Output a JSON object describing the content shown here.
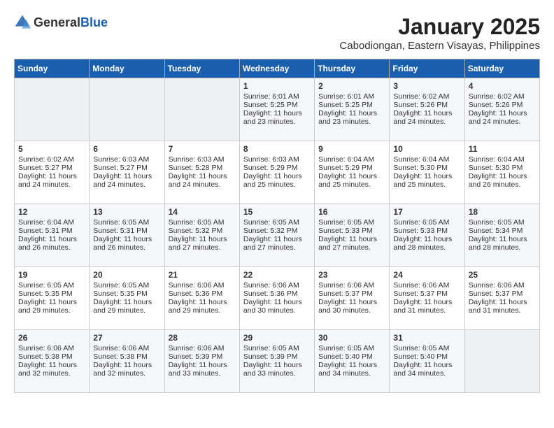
{
  "logo": {
    "general": "General",
    "blue": "Blue"
  },
  "title": "January 2025",
  "subtitle": "Cabodiongan, Eastern Visayas, Philippines",
  "weekdays": [
    "Sunday",
    "Monday",
    "Tuesday",
    "Wednesday",
    "Thursday",
    "Friday",
    "Saturday"
  ],
  "weeks": [
    [
      {
        "day": "",
        "sunrise": "",
        "sunset": "",
        "daylight": ""
      },
      {
        "day": "",
        "sunrise": "",
        "sunset": "",
        "daylight": ""
      },
      {
        "day": "",
        "sunrise": "",
        "sunset": "",
        "daylight": ""
      },
      {
        "day": "1",
        "sunrise": "Sunrise: 6:01 AM",
        "sunset": "Sunset: 5:25 PM",
        "daylight": "Daylight: 11 hours and 23 minutes."
      },
      {
        "day": "2",
        "sunrise": "Sunrise: 6:01 AM",
        "sunset": "Sunset: 5:25 PM",
        "daylight": "Daylight: 11 hours and 23 minutes."
      },
      {
        "day": "3",
        "sunrise": "Sunrise: 6:02 AM",
        "sunset": "Sunset: 5:26 PM",
        "daylight": "Daylight: 11 hours and 24 minutes."
      },
      {
        "day": "4",
        "sunrise": "Sunrise: 6:02 AM",
        "sunset": "Sunset: 5:26 PM",
        "daylight": "Daylight: 11 hours and 24 minutes."
      }
    ],
    [
      {
        "day": "5",
        "sunrise": "Sunrise: 6:02 AM",
        "sunset": "Sunset: 5:27 PM",
        "daylight": "Daylight: 11 hours and 24 minutes."
      },
      {
        "day": "6",
        "sunrise": "Sunrise: 6:03 AM",
        "sunset": "Sunset: 5:27 PM",
        "daylight": "Daylight: 11 hours and 24 minutes."
      },
      {
        "day": "7",
        "sunrise": "Sunrise: 6:03 AM",
        "sunset": "Sunset: 5:28 PM",
        "daylight": "Daylight: 11 hours and 24 minutes."
      },
      {
        "day": "8",
        "sunrise": "Sunrise: 6:03 AM",
        "sunset": "Sunset: 5:29 PM",
        "daylight": "Daylight: 11 hours and 25 minutes."
      },
      {
        "day": "9",
        "sunrise": "Sunrise: 6:04 AM",
        "sunset": "Sunset: 5:29 PM",
        "daylight": "Daylight: 11 hours and 25 minutes."
      },
      {
        "day": "10",
        "sunrise": "Sunrise: 6:04 AM",
        "sunset": "Sunset: 5:30 PM",
        "daylight": "Daylight: 11 hours and 25 minutes."
      },
      {
        "day": "11",
        "sunrise": "Sunrise: 6:04 AM",
        "sunset": "Sunset: 5:30 PM",
        "daylight": "Daylight: 11 hours and 26 minutes."
      }
    ],
    [
      {
        "day": "12",
        "sunrise": "Sunrise: 6:04 AM",
        "sunset": "Sunset: 5:31 PM",
        "daylight": "Daylight: 11 hours and 26 minutes."
      },
      {
        "day": "13",
        "sunrise": "Sunrise: 6:05 AM",
        "sunset": "Sunset: 5:31 PM",
        "daylight": "Daylight: 11 hours and 26 minutes."
      },
      {
        "day": "14",
        "sunrise": "Sunrise: 6:05 AM",
        "sunset": "Sunset: 5:32 PM",
        "daylight": "Daylight: 11 hours and 27 minutes."
      },
      {
        "day": "15",
        "sunrise": "Sunrise: 6:05 AM",
        "sunset": "Sunset: 5:32 PM",
        "daylight": "Daylight: 11 hours and 27 minutes."
      },
      {
        "day": "16",
        "sunrise": "Sunrise: 6:05 AM",
        "sunset": "Sunset: 5:33 PM",
        "daylight": "Daylight: 11 hours and 27 minutes."
      },
      {
        "day": "17",
        "sunrise": "Sunrise: 6:05 AM",
        "sunset": "Sunset: 5:33 PM",
        "daylight": "Daylight: 11 hours and 28 minutes."
      },
      {
        "day": "18",
        "sunrise": "Sunrise: 6:05 AM",
        "sunset": "Sunset: 5:34 PM",
        "daylight": "Daylight: 11 hours and 28 minutes."
      }
    ],
    [
      {
        "day": "19",
        "sunrise": "Sunrise: 6:05 AM",
        "sunset": "Sunset: 5:35 PM",
        "daylight": "Daylight: 11 hours and 29 minutes."
      },
      {
        "day": "20",
        "sunrise": "Sunrise: 6:05 AM",
        "sunset": "Sunset: 5:35 PM",
        "daylight": "Daylight: 11 hours and 29 minutes."
      },
      {
        "day": "21",
        "sunrise": "Sunrise: 6:06 AM",
        "sunset": "Sunset: 5:36 PM",
        "daylight": "Daylight: 11 hours and 29 minutes."
      },
      {
        "day": "22",
        "sunrise": "Sunrise: 6:06 AM",
        "sunset": "Sunset: 5:36 PM",
        "daylight": "Daylight: 11 hours and 30 minutes."
      },
      {
        "day": "23",
        "sunrise": "Sunrise: 6:06 AM",
        "sunset": "Sunset: 5:37 PM",
        "daylight": "Daylight: 11 hours and 30 minutes."
      },
      {
        "day": "24",
        "sunrise": "Sunrise: 6:06 AM",
        "sunset": "Sunset: 5:37 PM",
        "daylight": "Daylight: 11 hours and 31 minutes."
      },
      {
        "day": "25",
        "sunrise": "Sunrise: 6:06 AM",
        "sunset": "Sunset: 5:37 PM",
        "daylight": "Daylight: 11 hours and 31 minutes."
      }
    ],
    [
      {
        "day": "26",
        "sunrise": "Sunrise: 6:06 AM",
        "sunset": "Sunset: 5:38 PM",
        "daylight": "Daylight: 11 hours and 32 minutes."
      },
      {
        "day": "27",
        "sunrise": "Sunrise: 6:06 AM",
        "sunset": "Sunset: 5:38 PM",
        "daylight": "Daylight: 11 hours and 32 minutes."
      },
      {
        "day": "28",
        "sunrise": "Sunrise: 6:06 AM",
        "sunset": "Sunset: 5:39 PM",
        "daylight": "Daylight: 11 hours and 33 minutes."
      },
      {
        "day": "29",
        "sunrise": "Sunrise: 6:05 AM",
        "sunset": "Sunset: 5:39 PM",
        "daylight": "Daylight: 11 hours and 33 minutes."
      },
      {
        "day": "30",
        "sunrise": "Sunrise: 6:05 AM",
        "sunset": "Sunset: 5:40 PM",
        "daylight": "Daylight: 11 hours and 34 minutes."
      },
      {
        "day": "31",
        "sunrise": "Sunrise: 6:05 AM",
        "sunset": "Sunset: 5:40 PM",
        "daylight": "Daylight: 11 hours and 34 minutes."
      },
      {
        "day": "",
        "sunrise": "",
        "sunset": "",
        "daylight": ""
      }
    ]
  ]
}
